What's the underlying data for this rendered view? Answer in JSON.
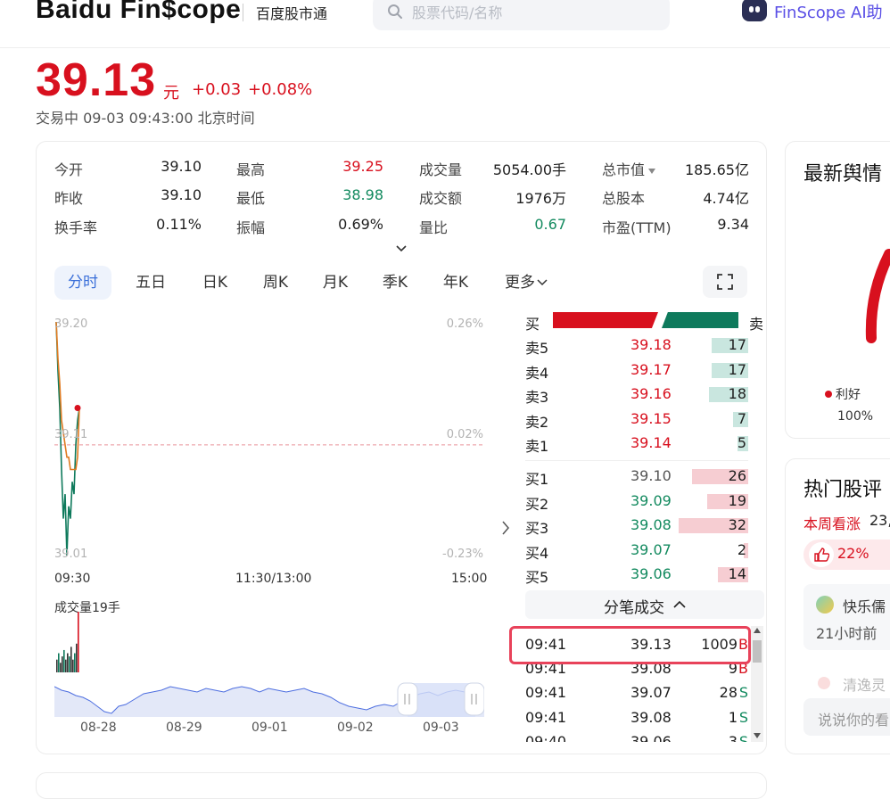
{
  "header": {
    "logo": "Baidu Fin$cope",
    "subtitle": "百度股市通",
    "search_placeholder": "股票代码/名称",
    "ai_label": "FinScope AI助"
  },
  "quote": {
    "price": "39.13",
    "unit": "元",
    "change": "+0.03",
    "change_pct": "+0.08%",
    "status": "交易中 09-03 09:43:00 北京时间"
  },
  "stats": [
    {
      "label": "今开",
      "value": "39.10"
    },
    {
      "label": "最高",
      "value": "39.25"
    },
    {
      "label": "成交量",
      "value": "5054.00手"
    },
    {
      "label": "总市值",
      "value": "185.65亿"
    },
    {
      "label": "昨收",
      "value": "39.10"
    },
    {
      "label": "最低",
      "value": "38.98"
    },
    {
      "label": "成交额",
      "value": "1976万"
    },
    {
      "label": "总股本",
      "value": "4.74亿"
    },
    {
      "label": "换手率",
      "value": "0.11%"
    },
    {
      "label": "振幅",
      "value": "0.69%"
    },
    {
      "label": "量比",
      "value": "0.67"
    },
    {
      "label": "市盈(TTM)",
      "value": "9.34"
    }
  ],
  "tabs": [
    "分时",
    "五日",
    "日K",
    "周K",
    "月K",
    "季K",
    "年K",
    "更多"
  ],
  "chart": {
    "y_top": "39.20",
    "y_mid": "39.11",
    "y_bot": "39.01",
    "pct_top": "0.26%",
    "pct_mid": "0.02%",
    "pct_bot": "-0.23%",
    "x_start": "09:30",
    "x_mid": "11:30/13:00",
    "x_end": "15:00",
    "volume_label": "成交量19手",
    "nav_dates": [
      "08-28",
      "08-29",
      "09-01",
      "09-02",
      "09-03"
    ]
  },
  "chart_data": {
    "type": "line",
    "x": [
      "09:30",
      "09:31",
      "09:32",
      "09:33",
      "09:34",
      "09:35",
      "09:36",
      "09:37",
      "09:38",
      "09:39",
      "09:40",
      "09:41",
      "09:42",
      "09:43"
    ],
    "series": [
      {
        "values": [
          39.2,
          39.16,
          39.13,
          39.08,
          39.04,
          39.06,
          39.01,
          39.05,
          39.04,
          39.07,
          39.06,
          39.1,
          39.12,
          39.13
        ]
      },
      {
        "values": [
          39.2,
          39.17,
          39.15,
          39.12,
          39.11,
          39.1,
          39.09,
          39.09,
          39.08,
          39.08,
          39.08,
          39.08,
          39.09,
          39.13
        ]
      }
    ],
    "prev_close": 39.1,
    "ylim": [
      39.01,
      39.2
    ],
    "volume": [
      4,
      6,
      3,
      5,
      7,
      4,
      6,
      5,
      8,
      4,
      6,
      9,
      19
    ]
  },
  "orderbook": {
    "buy_label": "买",
    "sell_label": "卖",
    "asks": [
      {
        "label": "卖5",
        "price": "39.18",
        "qty": "17",
        "frac": 0.53
      },
      {
        "label": "卖4",
        "price": "39.17",
        "qty": "17",
        "frac": 0.53
      },
      {
        "label": "卖3",
        "price": "39.16",
        "qty": "18",
        "frac": 0.56
      },
      {
        "label": "卖2",
        "price": "39.15",
        "qty": "7",
        "frac": 0.22
      },
      {
        "label": "卖1",
        "price": "39.14",
        "qty": "5",
        "frac": 0.16
      }
    ],
    "bids": [
      {
        "label": "买1",
        "price": "39.10",
        "qty": "26",
        "frac": 0.81
      },
      {
        "label": "买2",
        "price": "39.09",
        "qty": "19",
        "frac": 0.59
      },
      {
        "label": "买3",
        "price": "39.08",
        "qty": "32",
        "frac": 1.0
      },
      {
        "label": "买4",
        "price": "39.07",
        "qty": "2",
        "frac": 0.06
      },
      {
        "label": "买5",
        "price": "39.06",
        "qty": "14",
        "frac": 0.44
      }
    ]
  },
  "ticks": {
    "title": "分笔成交",
    "rows": [
      {
        "time": "09:41",
        "price": "39.13",
        "vol": "1009",
        "side": "B"
      },
      {
        "time": "09:41",
        "price": "39.08",
        "vol": "9",
        "side": "B"
      },
      {
        "time": "09:41",
        "price": "39.07",
        "vol": "28",
        "side": "S"
      },
      {
        "time": "09:41",
        "price": "39.08",
        "vol": "1",
        "side": "S"
      },
      {
        "time": "09:40",
        "price": "39.06",
        "vol": "3",
        "side": "S"
      }
    ]
  },
  "sentiment": {
    "title": "最新舆情",
    "label": "利好",
    "pct": "100%"
  },
  "hot": {
    "title": "热门股评",
    "week_label": "本周看涨",
    "week_count": "23,",
    "like_pct": "22%",
    "post_author": "快乐儒",
    "post_time": "21小时前",
    "post2_author": "清逸灵",
    "comment_placeholder": "说说你的看"
  },
  "colors": {
    "up": "#d8101e",
    "down": "#138a5f",
    "accent": "#3a6fd9",
    "highlight": "#e8425a"
  }
}
